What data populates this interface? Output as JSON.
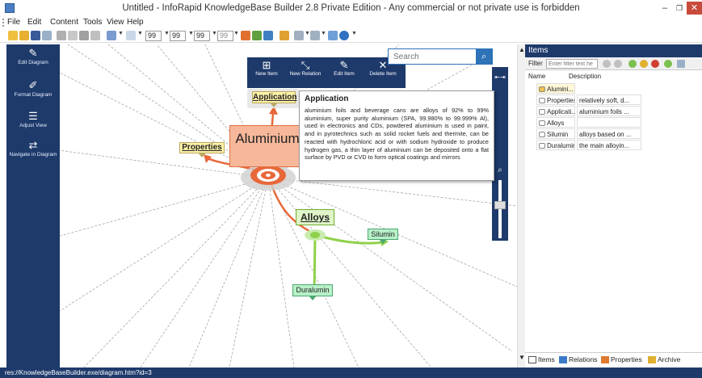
{
  "window": {
    "title": "Untitled - InfoRapid KnowledgeBase Builder 2.8 Private Edition - Any commercial or not private use is forbidden",
    "minimize": "–",
    "maximize": "❐",
    "close": "✕"
  },
  "menu": [
    "File",
    "Edit",
    "Content",
    "Tools",
    "View",
    "Help"
  ],
  "toolbar": {
    "field_values": [
      "99",
      "99",
      "99",
      "99"
    ]
  },
  "left_panel": {
    "buttons": [
      {
        "label": "Edit Diagram",
        "icon": "edit-icon"
      },
      {
        "label": "Format Diagram",
        "icon": "brush-icon"
      },
      {
        "label": "Adjust View",
        "icon": "adjust-view-icon"
      },
      {
        "label": "Navigate in Diagram",
        "icon": "navigate-icon"
      }
    ]
  },
  "context_toolbar": {
    "buttons": [
      {
        "label": "New Item",
        "icon": "new-item-icon"
      },
      {
        "label": "New Relation",
        "icon": "new-relation-icon"
      },
      {
        "label": "Edit Item",
        "icon": "edit-item-icon"
      },
      {
        "label": "Delete Item",
        "icon": "delete-icon"
      }
    ]
  },
  "search": {
    "placeholder": "Search"
  },
  "diagram": {
    "nodes": {
      "root": "Aluminium",
      "application": "Application",
      "properties": "Properties",
      "alloys": "Alloys",
      "silumin": "Silumin",
      "duralumin": "Duralumin"
    }
  },
  "tooltip": {
    "title": "Application",
    "body": "aluminium foils and beverage cans are alloys of 92% to 99% aluminium, super purity aluminium (SPA, 99.980% to 99.999% Al), used in electronics and CDs, powdered aluminium is used in paint, and in pyrotechnics such as solid rocket fuels and thermite, can be reacted with hydrochloric acid or with sodium hydroxide to produce hydrogen gas, a thin layer of aluminium can be deposited onto a flat surface by PVD or CVD to form optical coatings and mirrors"
  },
  "items_panel": {
    "header": "Items",
    "filter_label": "Filter",
    "filter_placeholder": "Enter filter text he",
    "columns": {
      "name": "Name",
      "description": "Description"
    },
    "root_item": "Alumini...",
    "rows": [
      {
        "name": "Properties",
        "description": "relatively soft, d..."
      },
      {
        "name": "Applicati...",
        "description": "aluminium foils ..."
      },
      {
        "name": "Alloys",
        "description": ""
      },
      {
        "name": "Silumin",
        "description": "alloys based on ..."
      },
      {
        "name": "Duralumin",
        "description": "the main alloyin..."
      }
    ],
    "tabs": [
      "Items",
      "Relations",
      "Properties",
      "Archive"
    ]
  },
  "status_bar": {
    "text": "res://KnowledgeBaseBuilder.exe/diagram.htm?id=3"
  },
  "colors": {
    "panel_navy": "#1e3a6b",
    "accent_blue": "#2e72b8",
    "root_fill": "#f7b79a",
    "root_edge": "#e07040",
    "alloy_green": "#8fd14a",
    "leaf_green": "#b8f0c8",
    "label_yellow": "#fff2a8"
  }
}
